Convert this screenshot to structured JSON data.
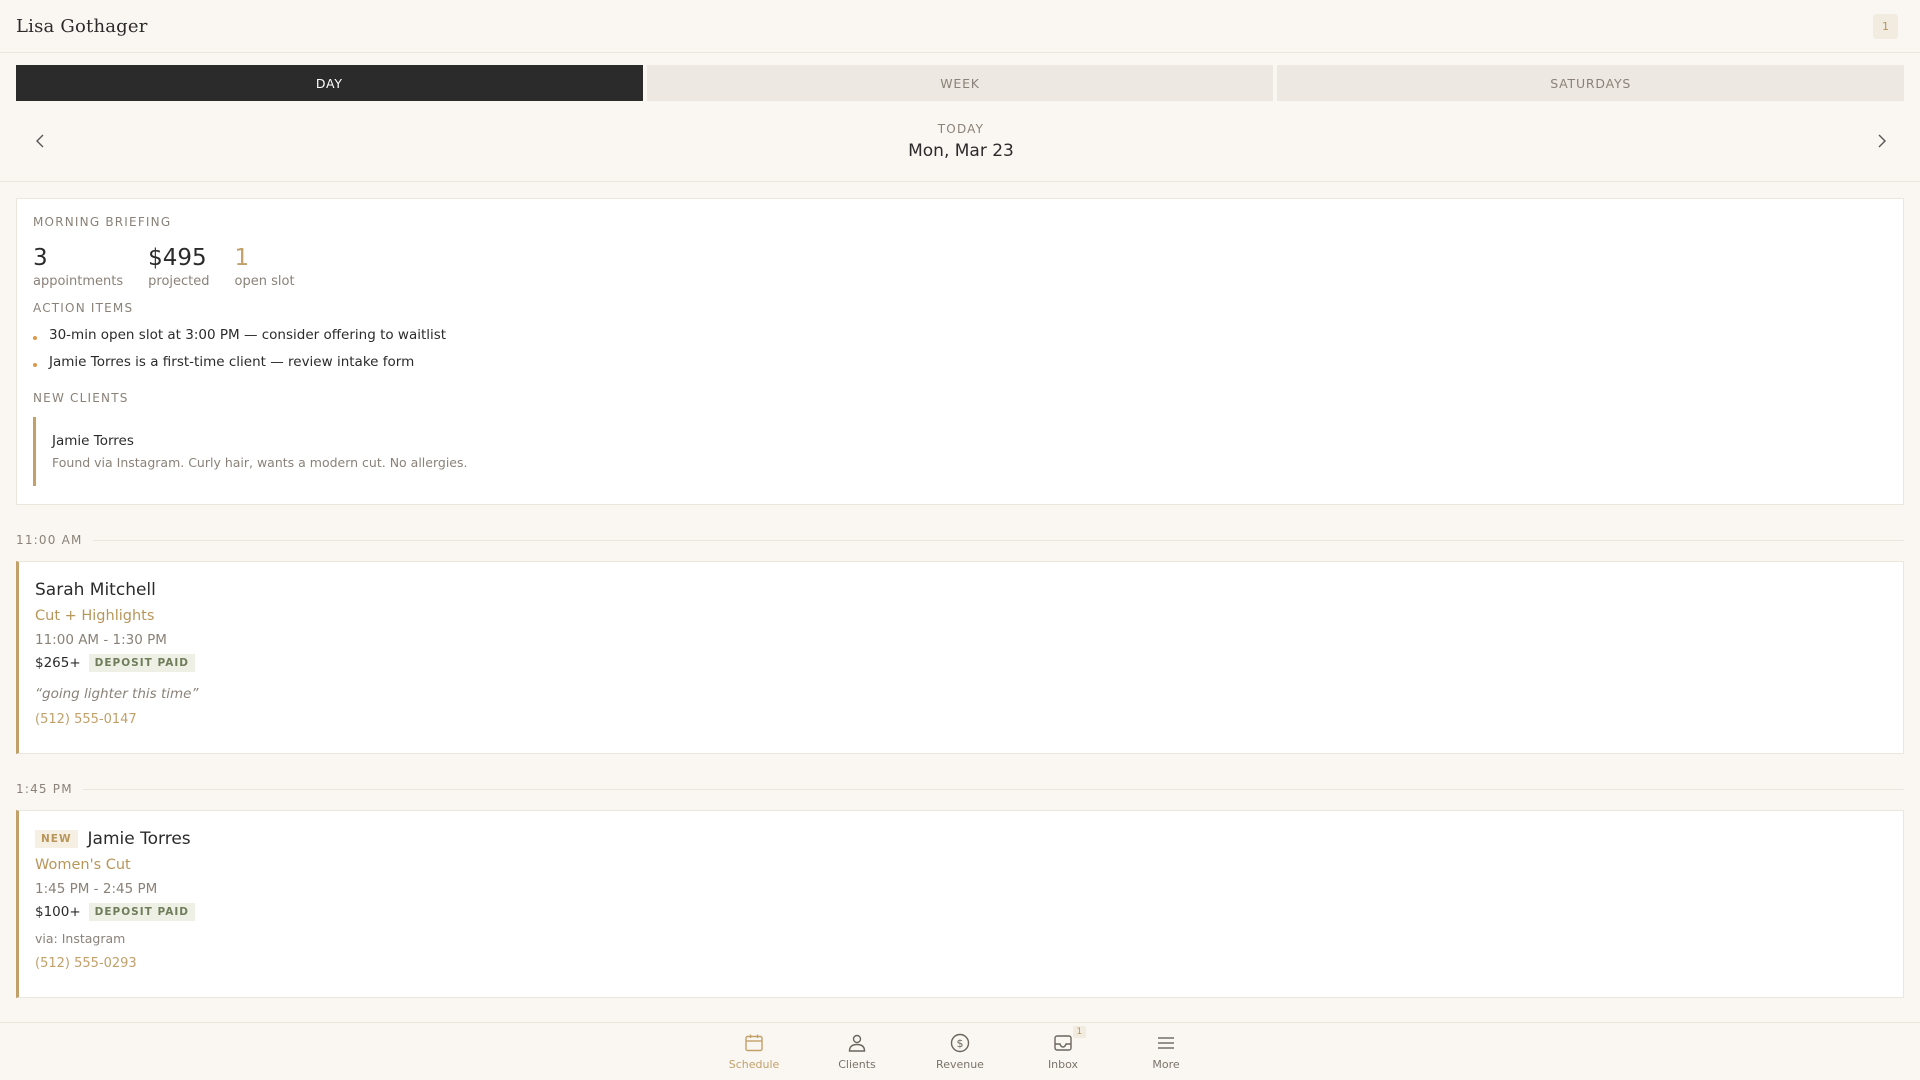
{
  "header": {
    "title": "Lisa Gothager",
    "notification_count": "1"
  },
  "tabs": [
    {
      "label": "DAY",
      "active": true
    },
    {
      "label": "WEEK",
      "active": false
    },
    {
      "label": "SATURDAYS",
      "active": false
    }
  ],
  "date_nav": {
    "today_label": "TODAY",
    "date": "Mon, Mar 23",
    "prev_icon": "chevron-left-icon",
    "next_icon": "chevron-right-icon"
  },
  "briefing": {
    "title": "MORNING BRIEFING",
    "stats": [
      {
        "value": "3",
        "label": "appointments"
      },
      {
        "value": "$495",
        "label": "projected"
      },
      {
        "value": "1",
        "label": "open slot"
      }
    ],
    "action_title": "ACTION ITEMS",
    "actions": [
      "30-min open slot at 3:00 PM — consider offering to waitlist",
      "Jamie Torres is a first-time client — review intake form"
    ],
    "new_clients_title": "NEW CLIENTS",
    "new_clients": [
      {
        "name": "Jamie Torres",
        "note": "Found via Instagram. Curly hair, wants a modern cut. No allergies."
      }
    ]
  },
  "appointments": [
    {
      "time_label": "11:00 AM",
      "name": "Sarah Mitchell",
      "service": "Cut + Highlights",
      "time_range": "11:00 AM - 1:30 PM",
      "price": "$265+",
      "deposit": "DEPOSIT PAID",
      "note": "“going lighter this time”",
      "phone": "(512) 555-0147"
    },
    {
      "time_label": "1:45 PM",
      "new_badge": "NEW",
      "name": "Jamie Torres",
      "service": "Women's Cut",
      "time_range": "1:45 PM - 2:45 PM",
      "price": "$100+",
      "deposit": "DEPOSIT PAID",
      "via": "via: Instagram",
      "phone": "(512) 555-0293"
    }
  ],
  "bottom_nav": [
    {
      "label": "Schedule",
      "icon": "calendar-icon",
      "active": true
    },
    {
      "label": "Clients",
      "icon": "person-icon",
      "active": false
    },
    {
      "label": "Revenue",
      "icon": "dollar-icon",
      "active": false
    },
    {
      "label": "Inbox",
      "icon": "inbox-icon",
      "active": false,
      "badge": "1"
    },
    {
      "label": "More",
      "icon": "menu-icon",
      "active": false
    }
  ],
  "colors": {
    "accent": "#c2a06a",
    "dark": "#2b2b2b",
    "muted": "#8a8278",
    "background": "#faf7f2"
  }
}
